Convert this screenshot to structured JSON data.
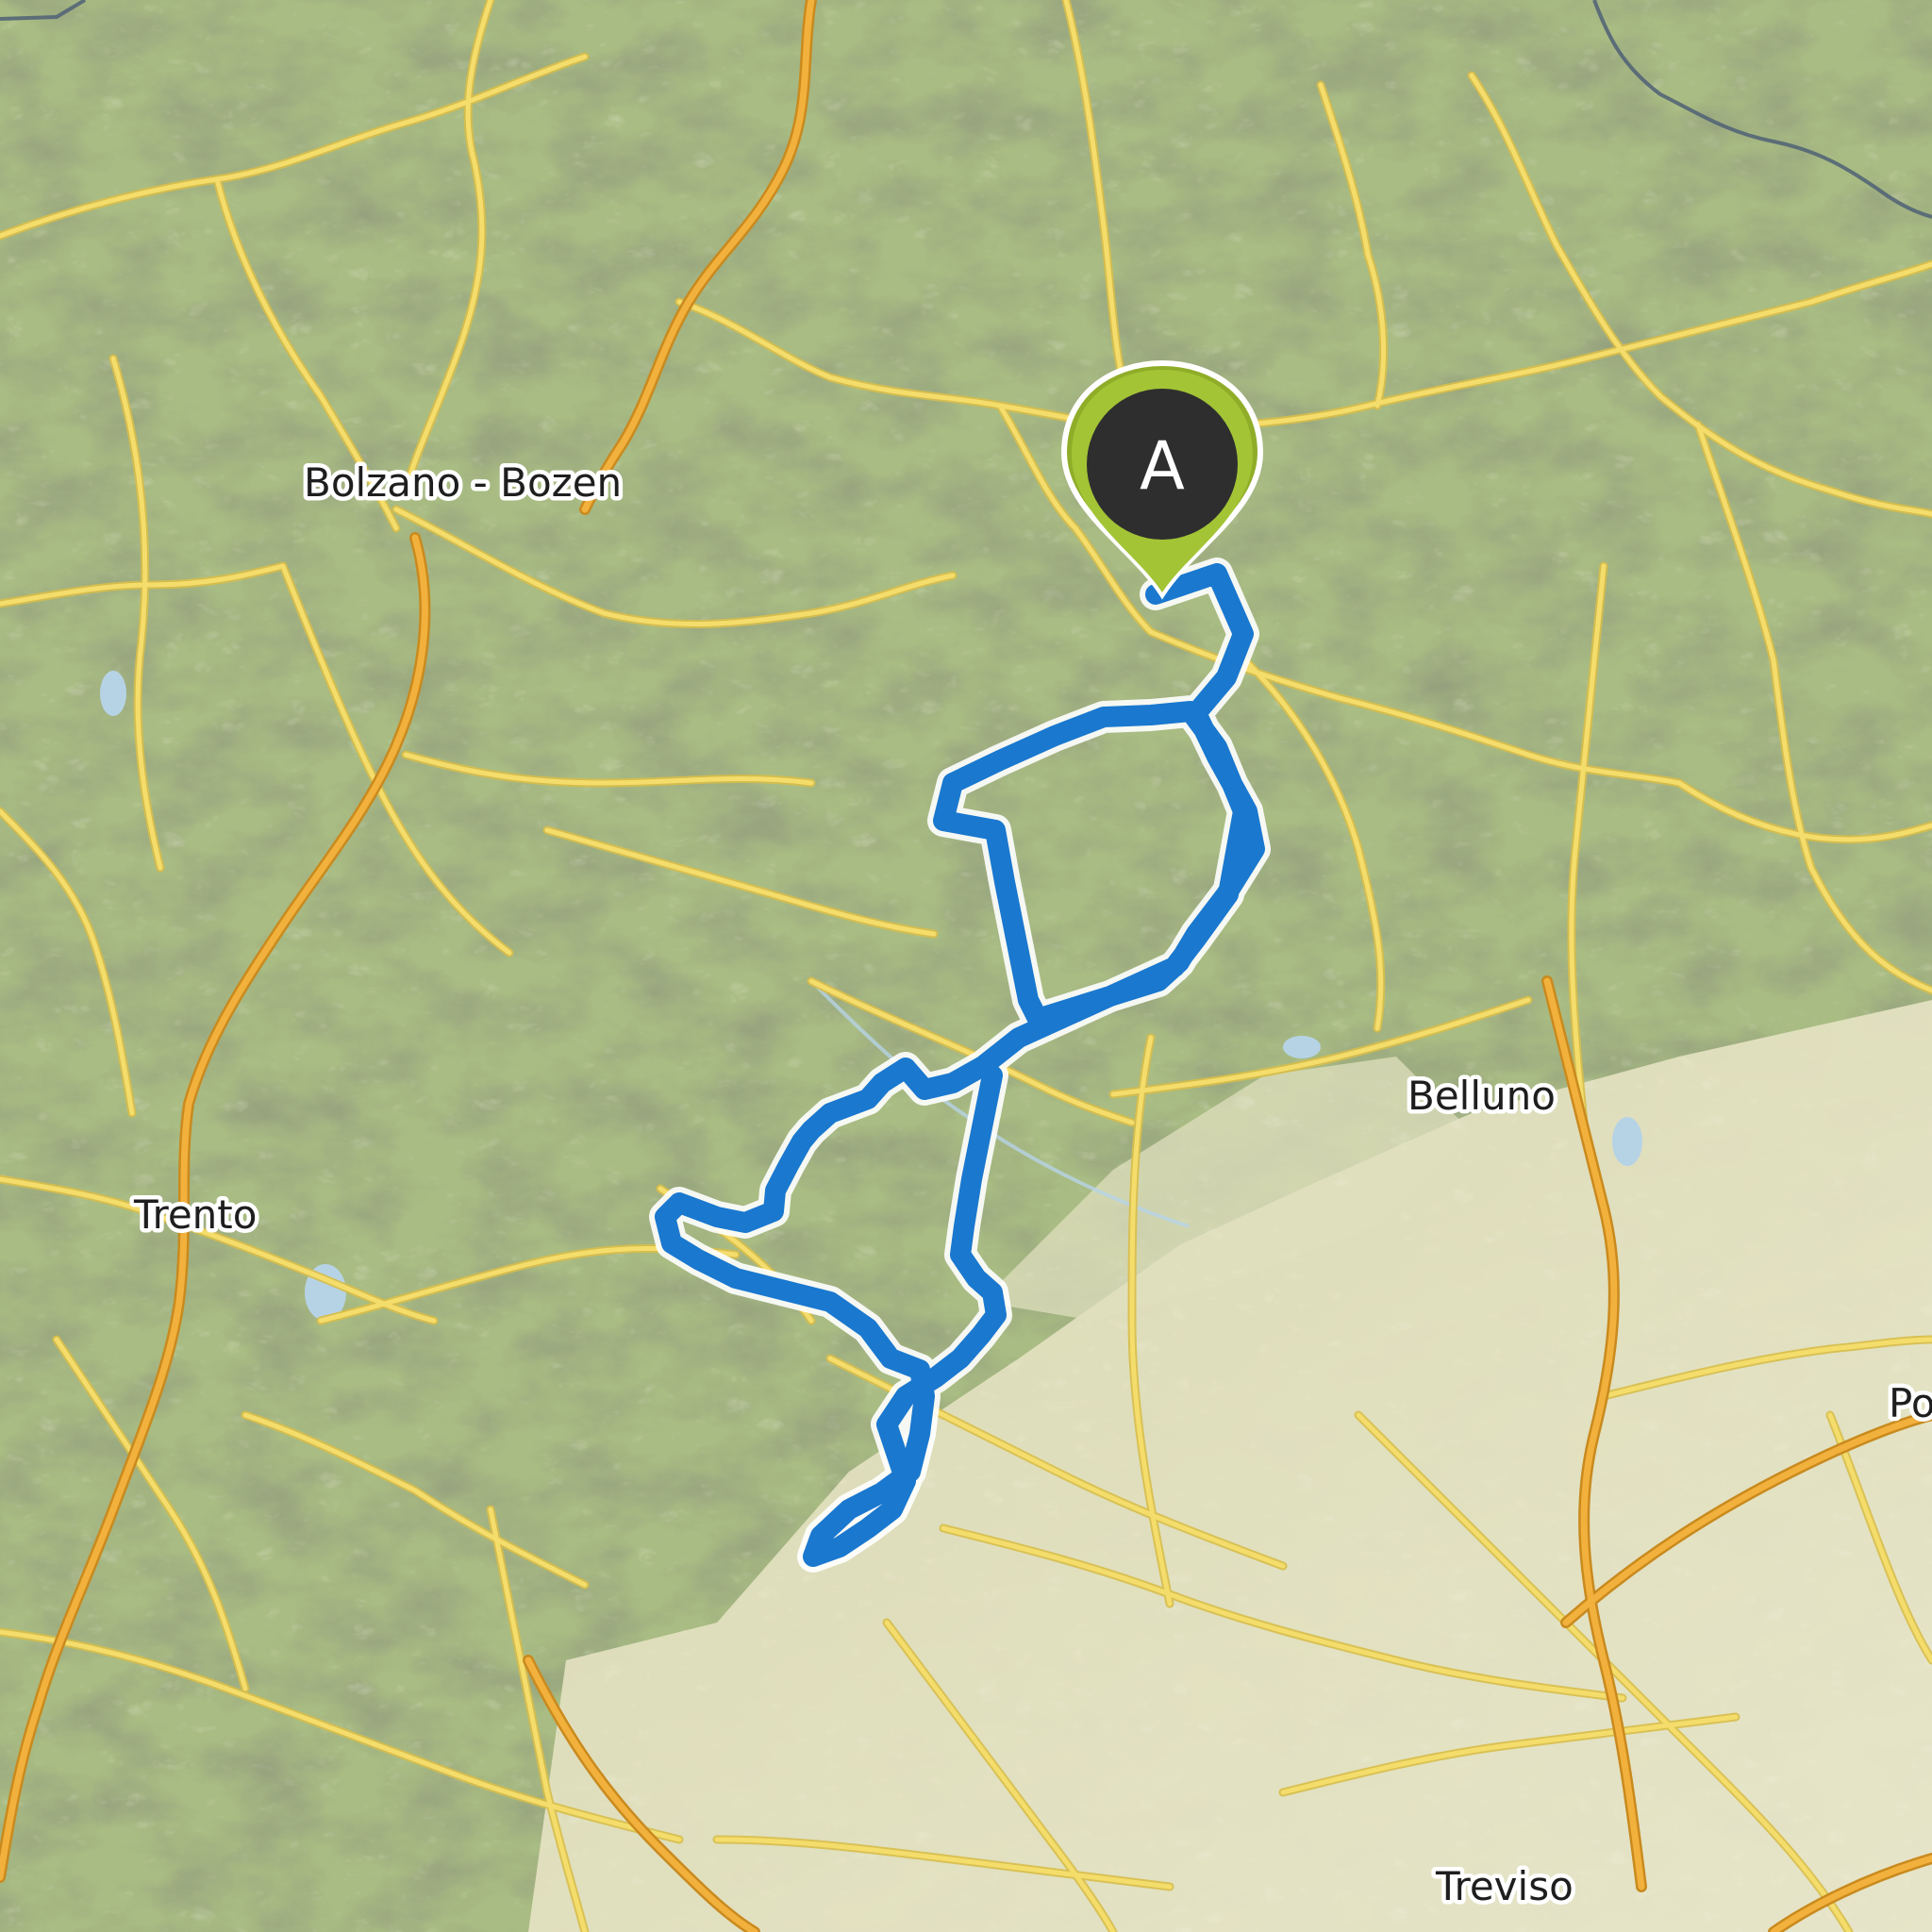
{
  "map": {
    "colors": {
      "terrain": "#a9bc83",
      "lowland": "#e9e6c9",
      "road": "#f5dd6c",
      "road_casing": "#d8be4a",
      "motorway": "#f2b13c",
      "border": "#4f6075",
      "route": "#1a78cf",
      "marker_pin": "#a3c435",
      "marker_disc": "#2e2e2e"
    },
    "labels": {
      "bolzano": "Bolzano - Bozen",
      "trento": "Trento",
      "belluno": "Belluno",
      "treviso": "Treviso",
      "partial_east": "Po"
    },
    "start_marker": {
      "letter": "A",
      "icon": "map-pin-icon"
    }
  }
}
